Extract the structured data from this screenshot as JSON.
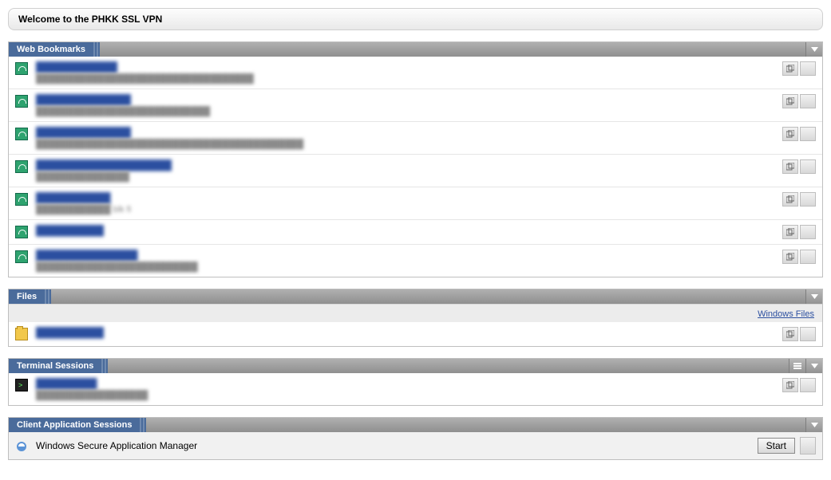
{
  "welcome": "Welcome to the PHKK SSL VPN",
  "panels": {
    "web": {
      "title": "Web Bookmarks",
      "items": [
        {
          "link": "████████████",
          "desc": "███████████████████████████████████"
        },
        {
          "link": "██████████████",
          "desc": "████████████████████████████"
        },
        {
          "link": "██████████████",
          "desc": "███████████████████████████████████████████"
        },
        {
          "link": "████████████████████",
          "desc": "███████████████"
        },
        {
          "link": "███████████",
          "desc": "████████████ blk fi"
        },
        {
          "link": "██████████",
          "desc": ""
        },
        {
          "link": "███████████████",
          "desc": "██████████████████████████"
        }
      ]
    },
    "files": {
      "title": "Files",
      "sublink": "Windows Files",
      "items": [
        {
          "link": "██████████",
          "desc": ""
        }
      ]
    },
    "terminal": {
      "title": "Terminal Sessions",
      "items": [
        {
          "link": "█████████",
          "desc": "██████████████████"
        }
      ]
    },
    "apps": {
      "title": "Client Application Sessions",
      "item_name": "Windows Secure Application Manager",
      "start_label": "Start"
    }
  }
}
